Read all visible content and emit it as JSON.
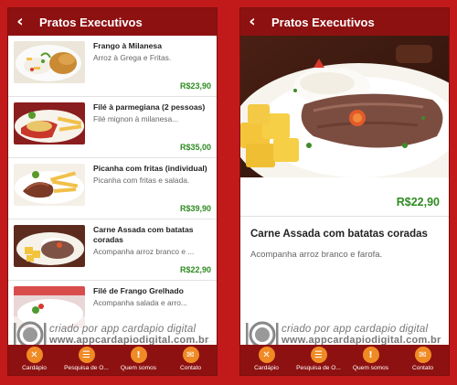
{
  "list_screen": {
    "title": "Pratos Executivos",
    "items": [
      {
        "name": "Frango à Milanesa",
        "desc": "Arroz à Grega e Fritas.",
        "price": "R$23,90"
      },
      {
        "name": "Filé à parmegiana (2 pessoas)",
        "desc": "Filé mignon à milanesa...",
        "price": "R$35,00"
      },
      {
        "name": "Picanha com fritas (individual)",
        "desc": "Picanha com fritas e salada.",
        "price": "R$39,90"
      },
      {
        "name": "Carne Assada com batatas coradas",
        "desc": "Acompanha arroz branco e ...",
        "price": "R$22,90"
      },
      {
        "name": "Filé de Frango Grelhado",
        "desc": "Acompanha salada e arro...",
        "price": ""
      }
    ]
  },
  "detail_screen": {
    "title": "Pratos Executivos",
    "price": "R$22,90",
    "name": "Carne Assada com batatas coradas",
    "desc": "Acompanha arroz branco e farofa."
  },
  "watermark": {
    "line1": "criado por app cardapio digital",
    "line2": "www.appcardapiodigital.com.br"
  },
  "nav": [
    {
      "label": "Cardápio",
      "icon": "utensils-icon"
    },
    {
      "label": "Pesquisa de O...",
      "icon": "clipboard-icon"
    },
    {
      "label": "Quem somos",
      "icon": "alert-icon"
    },
    {
      "label": "Contato",
      "icon": "mail-icon"
    }
  ],
  "colors": {
    "background": "#c21a1a",
    "appbar": "#8e1111",
    "price": "#2e8b22",
    "nav_icon": "#f08a24"
  }
}
